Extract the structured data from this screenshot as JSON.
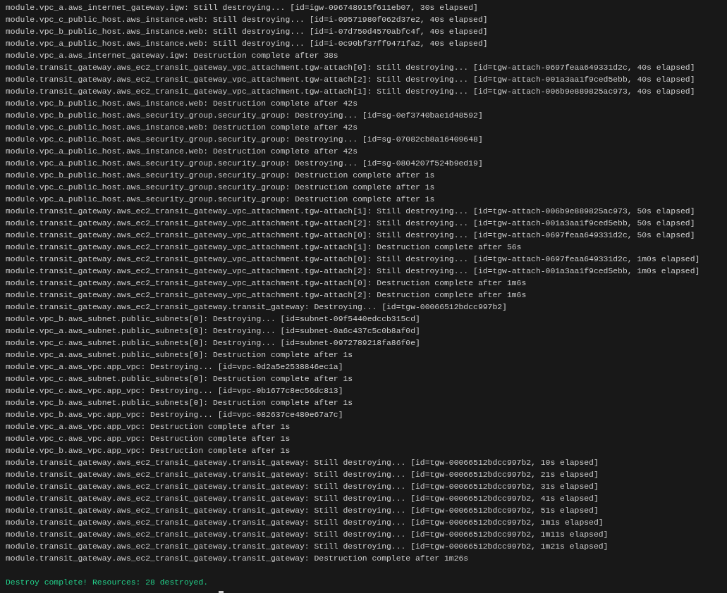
{
  "terminal": {
    "lines": [
      {
        "kind": "log",
        "text": "module.vpc_a.aws_internet_gateway.igw: Still destroying... [id=igw-096748915f611eb07, 30s elapsed]"
      },
      {
        "kind": "log",
        "text": "module.vpc_c_public_host.aws_instance.web: Still destroying... [id=i-09571980f062d37e2, 40s elapsed]"
      },
      {
        "kind": "log",
        "text": "module.vpc_b_public_host.aws_instance.web: Still destroying... [id=i-07d750d4570abfc4f, 40s elapsed]"
      },
      {
        "kind": "log",
        "text": "module.vpc_a_public_host.aws_instance.web: Still destroying... [id=i-0c90bf37ff9471fa2, 40s elapsed]"
      },
      {
        "kind": "log",
        "text": "module.vpc_a.aws_internet_gateway.igw: Destruction complete after 38s"
      },
      {
        "kind": "log",
        "text": "module.transit_gateway.aws_ec2_transit_gateway_vpc_attachment.tgw-attach[0]: Still destroying... [id=tgw-attach-0697feaa649331d2c, 40s elapsed]"
      },
      {
        "kind": "log",
        "text": "module.transit_gateway.aws_ec2_transit_gateway_vpc_attachment.tgw-attach[2]: Still destroying... [id=tgw-attach-001a3aa1f9ced5ebb, 40s elapsed]"
      },
      {
        "kind": "log",
        "text": "module.transit_gateway.aws_ec2_transit_gateway_vpc_attachment.tgw-attach[1]: Still destroying... [id=tgw-attach-006b9e889825ac973, 40s elapsed]"
      },
      {
        "kind": "log",
        "text": "module.vpc_b_public_host.aws_instance.web: Destruction complete after 42s"
      },
      {
        "kind": "log",
        "text": "module.vpc_b_public_host.aws_security_group.security_group: Destroying... [id=sg-0ef3740bae1d48592]"
      },
      {
        "kind": "log",
        "text": "module.vpc_c_public_host.aws_instance.web: Destruction complete after 42s"
      },
      {
        "kind": "log",
        "text": "module.vpc_c_public_host.aws_security_group.security_group: Destroying... [id=sg-07082cb8a16409648]"
      },
      {
        "kind": "log",
        "text": "module.vpc_a_public_host.aws_instance.web: Destruction complete after 42s"
      },
      {
        "kind": "log",
        "text": "module.vpc_a_public_host.aws_security_group.security_group: Destroying... [id=sg-0804207f524b9ed19]"
      },
      {
        "kind": "log",
        "text": "module.vpc_b_public_host.aws_security_group.security_group: Destruction complete after 1s"
      },
      {
        "kind": "log",
        "text": "module.vpc_c_public_host.aws_security_group.security_group: Destruction complete after 1s"
      },
      {
        "kind": "log",
        "text": "module.vpc_a_public_host.aws_security_group.security_group: Destruction complete after 1s"
      },
      {
        "kind": "log",
        "text": "module.transit_gateway.aws_ec2_transit_gateway_vpc_attachment.tgw-attach[1]: Still destroying... [id=tgw-attach-006b9e889825ac973, 50s elapsed]"
      },
      {
        "kind": "log",
        "text": "module.transit_gateway.aws_ec2_transit_gateway_vpc_attachment.tgw-attach[2]: Still destroying... [id=tgw-attach-001a3aa1f9ced5ebb, 50s elapsed]"
      },
      {
        "kind": "log",
        "text": "module.transit_gateway.aws_ec2_transit_gateway_vpc_attachment.tgw-attach[0]: Still destroying... [id=tgw-attach-0697feaa649331d2c, 50s elapsed]"
      },
      {
        "kind": "log",
        "text": "module.transit_gateway.aws_ec2_transit_gateway_vpc_attachment.tgw-attach[1]: Destruction complete after 56s"
      },
      {
        "kind": "log",
        "text": "module.transit_gateway.aws_ec2_transit_gateway_vpc_attachment.tgw-attach[0]: Still destroying... [id=tgw-attach-0697feaa649331d2c, 1m0s elapsed]"
      },
      {
        "kind": "log",
        "text": "module.transit_gateway.aws_ec2_transit_gateway_vpc_attachment.tgw-attach[2]: Still destroying... [id=tgw-attach-001a3aa1f9ced5ebb, 1m0s elapsed]"
      },
      {
        "kind": "log",
        "text": "module.transit_gateway.aws_ec2_transit_gateway_vpc_attachment.tgw-attach[0]: Destruction complete after 1m6s"
      },
      {
        "kind": "log",
        "text": "module.transit_gateway.aws_ec2_transit_gateway_vpc_attachment.tgw-attach[2]: Destruction complete after 1m6s"
      },
      {
        "kind": "log",
        "text": "module.transit_gateway.aws_ec2_transit_gateway.transit_gateway: Destroying... [id=tgw-00066512bdcc997b2]"
      },
      {
        "kind": "log",
        "text": "module.vpc_b.aws_subnet.public_subnets[0]: Destroying... [id=subnet-09f5440edccb315cd]"
      },
      {
        "kind": "log",
        "text": "module.vpc_a.aws_subnet.public_subnets[0]: Destroying... [id=subnet-0a6c437c5c0b8af0d]"
      },
      {
        "kind": "log",
        "text": "module.vpc_c.aws_subnet.public_subnets[0]: Destroying... [id=subnet-0972789218fa86f0e]"
      },
      {
        "kind": "log",
        "text": "module.vpc_a.aws_subnet.public_subnets[0]: Destruction complete after 1s"
      },
      {
        "kind": "log",
        "text": "module.vpc_a.aws_vpc.app_vpc: Destroying... [id=vpc-0d2a5e2538846ec1a]"
      },
      {
        "kind": "log",
        "text": "module.vpc_c.aws_subnet.public_subnets[0]: Destruction complete after 1s"
      },
      {
        "kind": "log",
        "text": "module.vpc_c.aws_vpc.app_vpc: Destroying... [id=vpc-0b1677c8ec56dc813]"
      },
      {
        "kind": "log",
        "text": "module.vpc_b.aws_subnet.public_subnets[0]: Destruction complete after 1s"
      },
      {
        "kind": "log",
        "text": "module.vpc_b.aws_vpc.app_vpc: Destroying... [id=vpc-082637ce480e67a7c]"
      },
      {
        "kind": "log",
        "text": "module.vpc_a.aws_vpc.app_vpc: Destruction complete after 1s"
      },
      {
        "kind": "log",
        "text": "module.vpc_c.aws_vpc.app_vpc: Destruction complete after 1s"
      },
      {
        "kind": "log",
        "text": "module.vpc_b.aws_vpc.app_vpc: Destruction complete after 1s"
      },
      {
        "kind": "log",
        "text": "module.transit_gateway.aws_ec2_transit_gateway.transit_gateway: Still destroying... [id=tgw-00066512bdcc997b2, 10s elapsed]"
      },
      {
        "kind": "log",
        "text": "module.transit_gateway.aws_ec2_transit_gateway.transit_gateway: Still destroying... [id=tgw-00066512bdcc997b2, 21s elapsed]"
      },
      {
        "kind": "log",
        "text": "module.transit_gateway.aws_ec2_transit_gateway.transit_gateway: Still destroying... [id=tgw-00066512bdcc997b2, 31s elapsed]"
      },
      {
        "kind": "log",
        "text": "module.transit_gateway.aws_ec2_transit_gateway.transit_gateway: Still destroying... [id=tgw-00066512bdcc997b2, 41s elapsed]"
      },
      {
        "kind": "log",
        "text": "module.transit_gateway.aws_ec2_transit_gateway.transit_gateway: Still destroying... [id=tgw-00066512bdcc997b2, 51s elapsed]"
      },
      {
        "kind": "log",
        "text": "module.transit_gateway.aws_ec2_transit_gateway.transit_gateway: Still destroying... [id=tgw-00066512bdcc997b2, 1m1s elapsed]"
      },
      {
        "kind": "log",
        "text": "module.transit_gateway.aws_ec2_transit_gateway.transit_gateway: Still destroying... [id=tgw-00066512bdcc997b2, 1m11s elapsed]"
      },
      {
        "kind": "log",
        "text": "module.transit_gateway.aws_ec2_transit_gateway.transit_gateway: Still destroying... [id=tgw-00066512bdcc997b2, 1m21s elapsed]"
      },
      {
        "kind": "log",
        "text": "module.transit_gateway.aws_ec2_transit_gateway.transit_gateway: Destruction complete after 1m26s"
      },
      {
        "kind": "success",
        "text": "Destroy complete! Resources: 28 destroyed."
      }
    ]
  }
}
